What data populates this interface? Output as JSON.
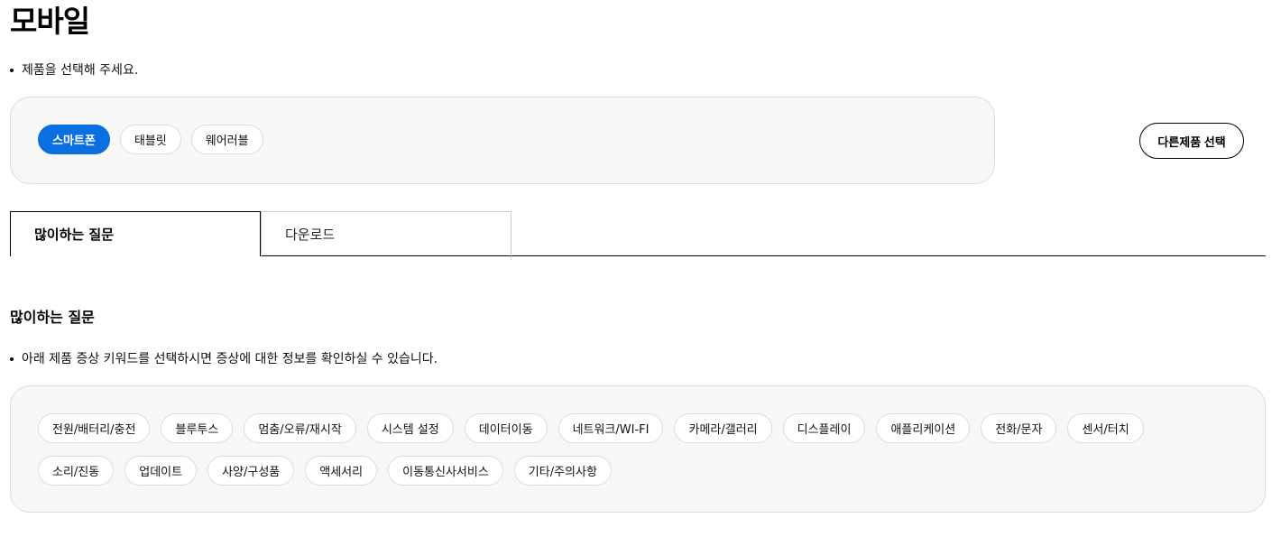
{
  "page_title": "모바일",
  "product_instruction": "제품을 선택해 주세요.",
  "product_types": [
    {
      "label": "스마트폰",
      "active": true
    },
    {
      "label": "태블릿",
      "active": false
    },
    {
      "label": "웨어러블",
      "active": false
    }
  ],
  "other_product_button": "다른제품 선택",
  "tabs": [
    {
      "label": "많이하는 질문",
      "active": true
    },
    {
      "label": "다운로드",
      "active": false
    }
  ],
  "faq": {
    "title": "많이하는 질문",
    "instruction": "아래 제품 증상 키워드를 선택하시면 증상에 대한 정보를 확인하실 수 있습니다.",
    "keywords": [
      "전원/배터리/충전",
      "블루투스",
      "멈춤/오류/재시작",
      "시스템 설정",
      "데이터이동",
      "네트워크/WI-FI",
      "카메라/갤러리",
      "디스플레이",
      "애플리케이션",
      "전화/문자",
      "센서/터치",
      "소리/진동",
      "업데이트",
      "사양/구성품",
      "액세서리",
      "이동통신사서비스",
      "기타/주의사항"
    ]
  },
  "colors": {
    "accent": "#0a6fe0",
    "panel_bg": "#f7f7f7",
    "panel_border": "#dddddd"
  }
}
